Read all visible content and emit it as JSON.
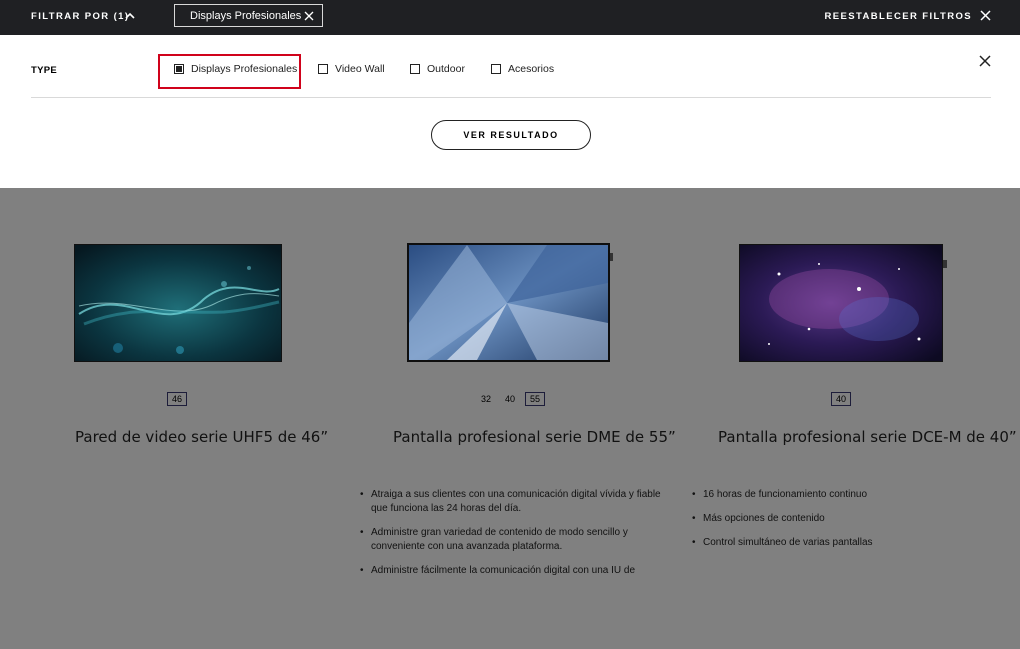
{
  "topbar": {
    "filter_label": "FILTRAR POR (1)",
    "chip_label": "Displays Profesionales",
    "reset_label": "REESTABLECER FILTROS"
  },
  "filter": {
    "type_label": "TYPE",
    "options": [
      {
        "label": "Displays Profesionales",
        "checked": true
      },
      {
        "label": "Video Wall",
        "checked": false
      },
      {
        "label": "Outdoor",
        "checked": false
      },
      {
        "label": "Acesorios",
        "checked": false
      }
    ],
    "submit_label": "VER RESULTADO"
  },
  "products": [
    {
      "title": "Pared de video serie UHF5 de 46”",
      "sizes": [
        {
          "label": "46",
          "active": true
        }
      ],
      "bullets": []
    },
    {
      "title": "Pantalla profesional serie DME de 55”",
      "sizes": [
        {
          "label": "32",
          "active": false
        },
        {
          "label": "40",
          "active": false
        },
        {
          "label": "55",
          "active": true
        }
      ],
      "bullets": [
        "Atraiga a sus clientes con una comunicación digital vívida y fiable que funciona las 24 horas del día.",
        "Administre gran variedad de contenido de modo sencillo y conveniente con una avanzada plataforma.",
        "Administre fácilmente la comunicación digital con una IU de"
      ]
    },
    {
      "title": "Pantalla profesional serie DCE-M de 40”",
      "sizes": [
        {
          "label": "40",
          "active": true
        }
      ],
      "bullets": [
        "16 horas de funcionamiento continuo",
        "Más opciones de contenido",
        "Control simultáneo de varias pantallas"
      ]
    }
  ],
  "colors": {
    "highlight": "#d0021b",
    "topbar": "#1f2023",
    "overlay": "#808080"
  }
}
